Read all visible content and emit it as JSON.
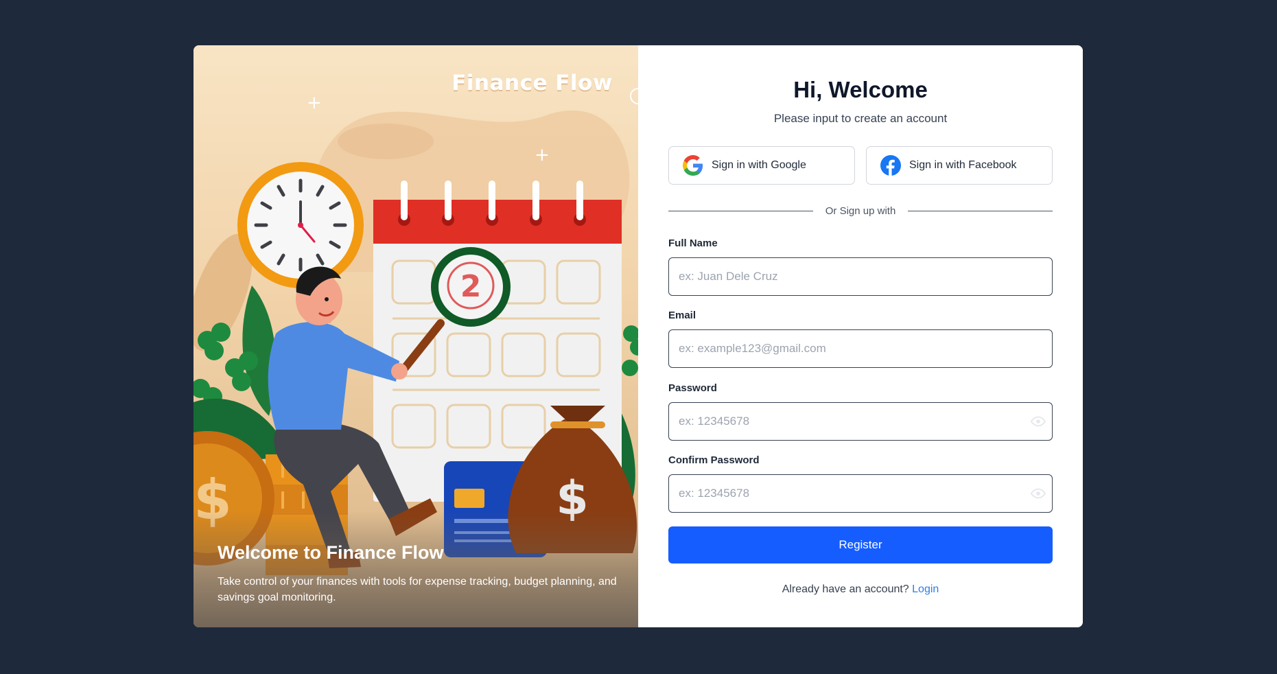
{
  "hero": {
    "brand": "Finance Flow",
    "title": "Welcome to Finance Flow",
    "description": "Take control of your finances with tools for expense tracking, budget planning, and savings goal monitoring.",
    "illustration_badge": "2",
    "illustration_currency": "$"
  },
  "form": {
    "heading": "Hi, Welcome",
    "subheading": "Please input to create an account",
    "google_label": "Sign in with Google",
    "facebook_label": "Sign in with Facebook",
    "divider_text": "Or Sign up with",
    "fields": {
      "full_name": {
        "label": "Full Name",
        "placeholder": "ex: Juan Dele Cruz",
        "value": ""
      },
      "email": {
        "label": "Email",
        "placeholder": "ex: example123@gmail.com",
        "value": ""
      },
      "password": {
        "label": "Password",
        "placeholder": "ex: 12345678",
        "value": ""
      },
      "confirm_password": {
        "label": "Confirm Password",
        "placeholder": "ex: 12345678",
        "value": ""
      }
    },
    "register_label": "Register",
    "login_prompt": "Already have an account?",
    "login_link": "Login"
  },
  "icons": {
    "google": "google-logo-icon",
    "facebook": "facebook-logo-icon",
    "eye": "eye-icon"
  },
  "colors": {
    "background": "#1e293b",
    "primary": "#165dff",
    "link": "#2b7de9",
    "facebook": "#1877f2"
  }
}
